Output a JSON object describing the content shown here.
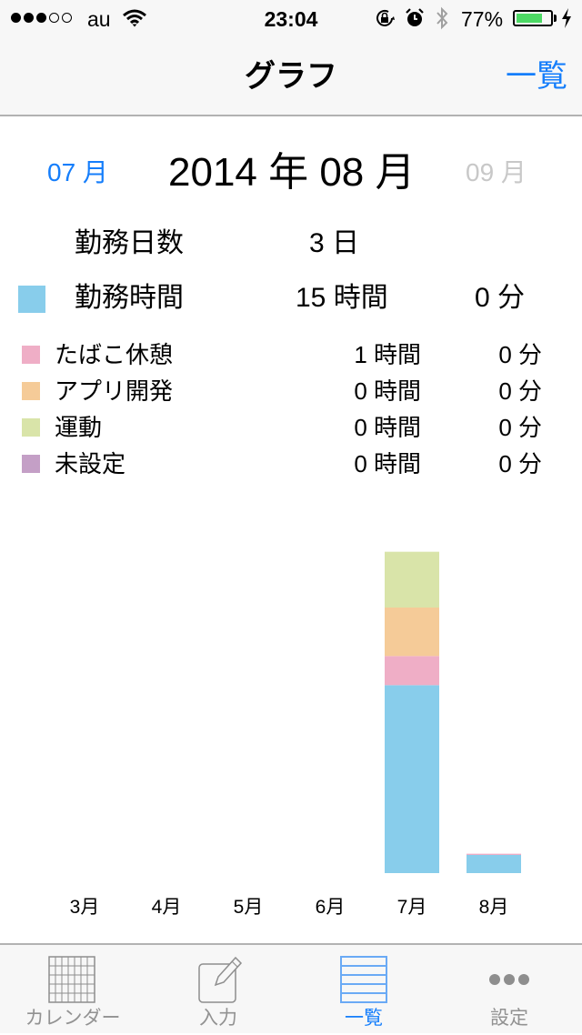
{
  "status_bar": {
    "signal_strength": 3,
    "signal_max": 5,
    "carrier": "au",
    "wifi_icon": "wifi-icon",
    "time": "23:04",
    "orientation_lock_icon": "orientation-lock-icon",
    "alarm_icon": "alarm-icon",
    "bluetooth_icon": "bluetooth-icon",
    "battery_text": "77%",
    "battery_level": 0.77,
    "battery_color": "#4cd964",
    "charging_icon": "bolt-icon"
  },
  "nav": {
    "title": "グラフ",
    "right_button": "一覧",
    "accent_color": "#157efb"
  },
  "month_nav": {
    "prev": "07 月",
    "current": "2014 年 08 月",
    "next": "09 月"
  },
  "summary": {
    "work_days_label": "勤務日数",
    "work_days_value": "3 日",
    "work_time_label": "勤務時間",
    "work_time_hours": "15 時間",
    "work_time_minutes": "0 分",
    "work_time_color": "#88cdeb"
  },
  "categories": [
    {
      "label": "たばこ休憩",
      "hours": "1 時間",
      "minutes": "0 分",
      "color": "#efaec6"
    },
    {
      "label": "アプリ開発",
      "hours": "0 時間",
      "minutes": "0 分",
      "color": "#f5cb98"
    },
    {
      "label": "運動",
      "hours": "0 時間",
      "minutes": "0 分",
      "color": "#d9e4a9"
    },
    {
      "label": "未設定",
      "hours": "0 時間",
      "minutes": "0 分",
      "color": "#c49fc6"
    }
  ],
  "tabs": [
    {
      "label": "カレンダー",
      "icon": "calendar-grid-icon",
      "selected": false
    },
    {
      "label": "入力",
      "icon": "note-pencil-icon",
      "selected": false
    },
    {
      "label": "一覧",
      "icon": "list-icon",
      "selected": true
    },
    {
      "label": "設定",
      "icon": "more-dots-icon",
      "selected": false
    }
  ],
  "chart_data": {
    "type": "bar",
    "stacked": true,
    "title": "",
    "xlabel": "",
    "ylabel": "",
    "unit": "hours (approx.)",
    "categories": [
      "3月",
      "4月",
      "5月",
      "6月",
      "7月",
      "8月"
    ],
    "series": [
      {
        "name": "勤務時間",
        "color": "#88cdeb",
        "values": [
          0,
          0,
          0,
          0,
          155,
          15
        ]
      },
      {
        "name": "たばこ休憩",
        "color": "#efaec6",
        "values": [
          0,
          0,
          0,
          0,
          24,
          1
        ]
      },
      {
        "name": "アプリ開発",
        "color": "#f5cb98",
        "values": [
          0,
          0,
          0,
          0,
          40,
          0
        ]
      },
      {
        "name": "運動",
        "color": "#d9e4a9",
        "values": [
          0,
          0,
          0,
          0,
          46,
          0
        ]
      },
      {
        "name": "未設定",
        "color": "#c49fc6",
        "values": [
          0,
          0,
          0,
          0,
          0,
          0
        ]
      }
    ],
    "ylim": [
      0,
      300
    ],
    "grid": false,
    "legend": "top (list above chart)"
  }
}
